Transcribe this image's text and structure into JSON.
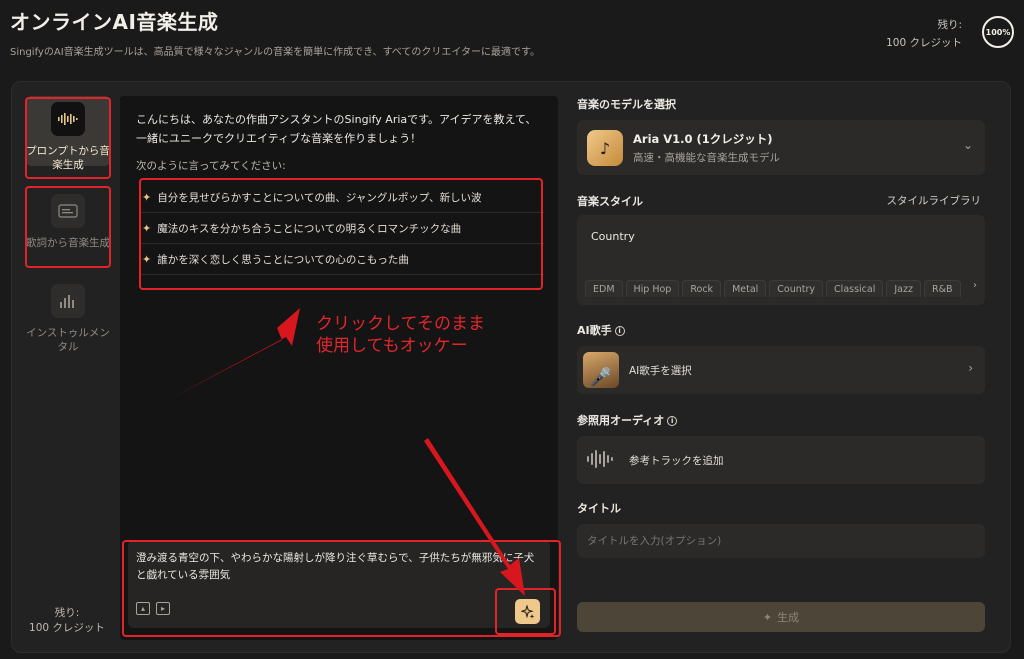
{
  "header": {
    "title": "オンラインAI音楽生成",
    "subtitle": "SingifyのAI音楽生成ツールは、高品質で様々なジャンルの音楽を簡単に作成でき、すべてのクリエイターに最適です。",
    "credits_label": "残り:",
    "credits_value": "100 クレジット",
    "credits_percent": "100%"
  },
  "nav": {
    "items": [
      {
        "label": "プロンプトから音楽生成",
        "icon": "waveform-icon",
        "active": true
      },
      {
        "label": "歌詞から音楽生成",
        "icon": "lyrics-icon",
        "active": false
      },
      {
        "label": "インストゥルメンタル",
        "icon": "equalizer-icon",
        "active": false
      }
    ],
    "credits_label": "残り:",
    "credits_value": "100 クレジット"
  },
  "chat": {
    "greeting": "こんにちは、あなたの作曲アシスタントのSingify Ariaです。アイデアを教えて、一緒にユニークでクリエイティブな音楽を作りましょう！",
    "try_label": "次のように言ってみてください:",
    "suggestions": [
      "自分を見せびらかすことについての曲、ジャングルポップ、新しい波",
      "魔法のキスを分かち合うことについての明るくロマンチックな曲",
      "誰かを深く恋しく思うことについての心のこもった曲"
    ],
    "annotation_line1": "クリックしてそのまま",
    "annotation_line2": "使用してもオッケー",
    "input_text": "澄み渡る青空の下、やわらかな陽射しが降り注ぐ草むらで、子供たちが無邪気に子犬と戯れている雰囲気"
  },
  "settings": {
    "model_section": "音楽のモデルを選択",
    "model_name": "Aria V1.0 (1クレジット)",
    "model_desc": "高速・高機能な音楽生成モデル",
    "style_section": "音楽スタイル",
    "style_library": "スタイルライブラリ",
    "style_value": "Country",
    "style_chips": [
      "EDM",
      "Hip Hop",
      "Rock",
      "Metal",
      "Country",
      "Classical",
      "Jazz",
      "R&B"
    ],
    "singer_section": "AI歌手",
    "singer_select": "AI歌手を選択",
    "ref_section": "参照用オーディオ",
    "ref_add": "参考トラックを追加",
    "title_section": "タイトル",
    "title_placeholder": "タイトルを入力(オプション)",
    "generate_label": "生成"
  },
  "colors": {
    "accent": "#efc98c",
    "annotation": "#e0242a",
    "background": "#1b1a1a"
  }
}
